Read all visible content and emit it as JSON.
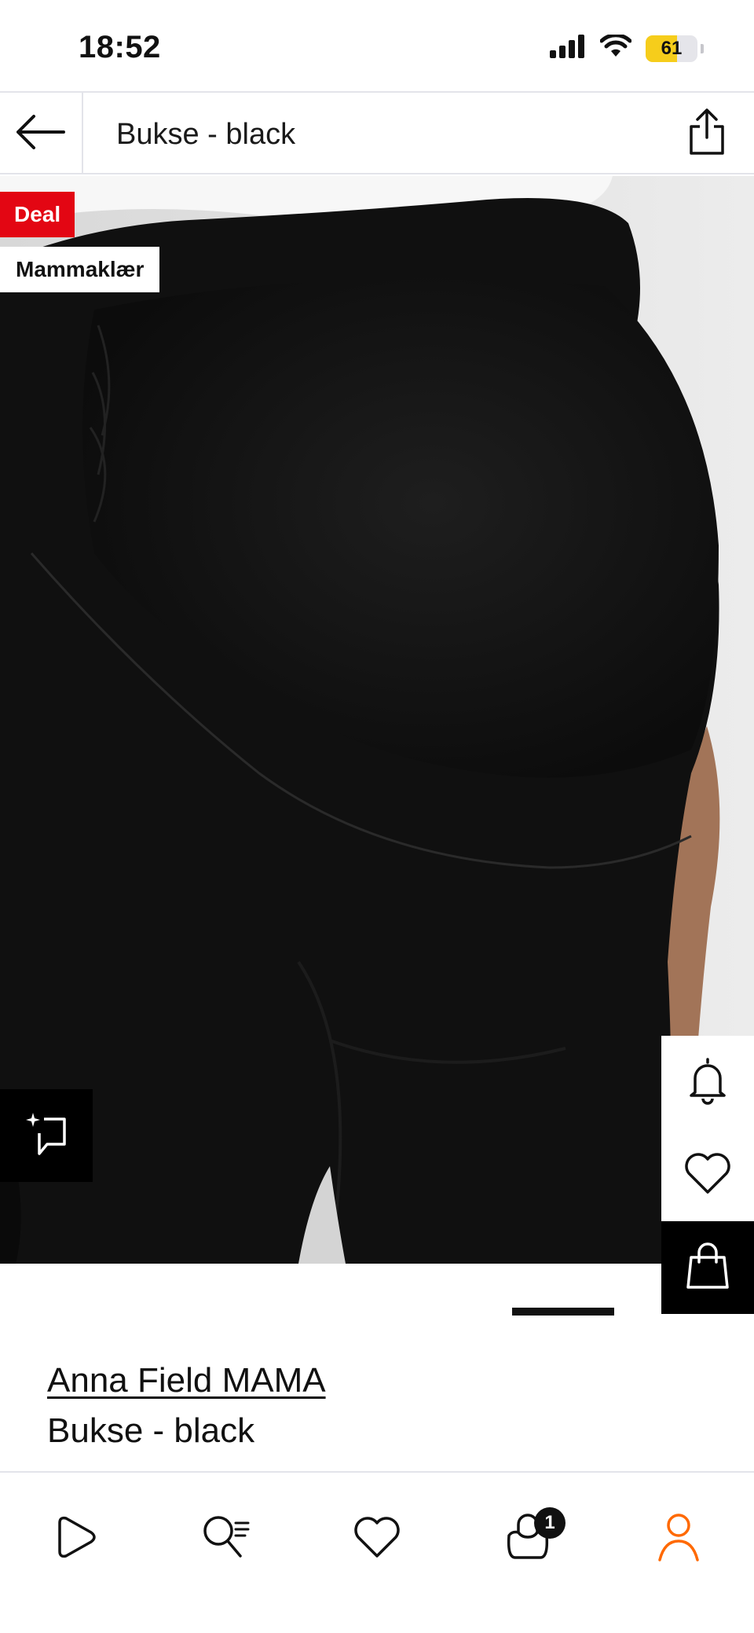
{
  "status_bar": {
    "time": "18:52",
    "battery_level": "61",
    "battery_fraction": 0.61,
    "icons": [
      "cellular-signal-icon",
      "wifi-icon",
      "battery-icon"
    ]
  },
  "header": {
    "title": "Bukse - black",
    "back_icon": "arrow-left-icon",
    "share_icon": "share-icon"
  },
  "product": {
    "badges": {
      "deal": "Deal",
      "category": "Mammaklær"
    },
    "brand": "Anna Field MAMA",
    "name": "Bukse - black",
    "image_index": 1
  },
  "actions": {
    "similar_icon": "sparkle-frame-icon",
    "notify_icon": "bell-icon",
    "wishlist_icon": "heart-icon",
    "add_to_bag_icon": "shopping-bag-icon"
  },
  "bottom_nav": {
    "items": [
      {
        "icon": "play-icon"
      },
      {
        "icon": "search-icon"
      },
      {
        "icon": "heart-icon"
      },
      {
        "icon": "bag-icon",
        "badge": "1"
      },
      {
        "icon": "profile-icon"
      }
    ]
  },
  "colors": {
    "deal_red": "#e30613",
    "accent_orange": "#ff6900",
    "text": "#111111",
    "divider": "#e3e4ea"
  }
}
